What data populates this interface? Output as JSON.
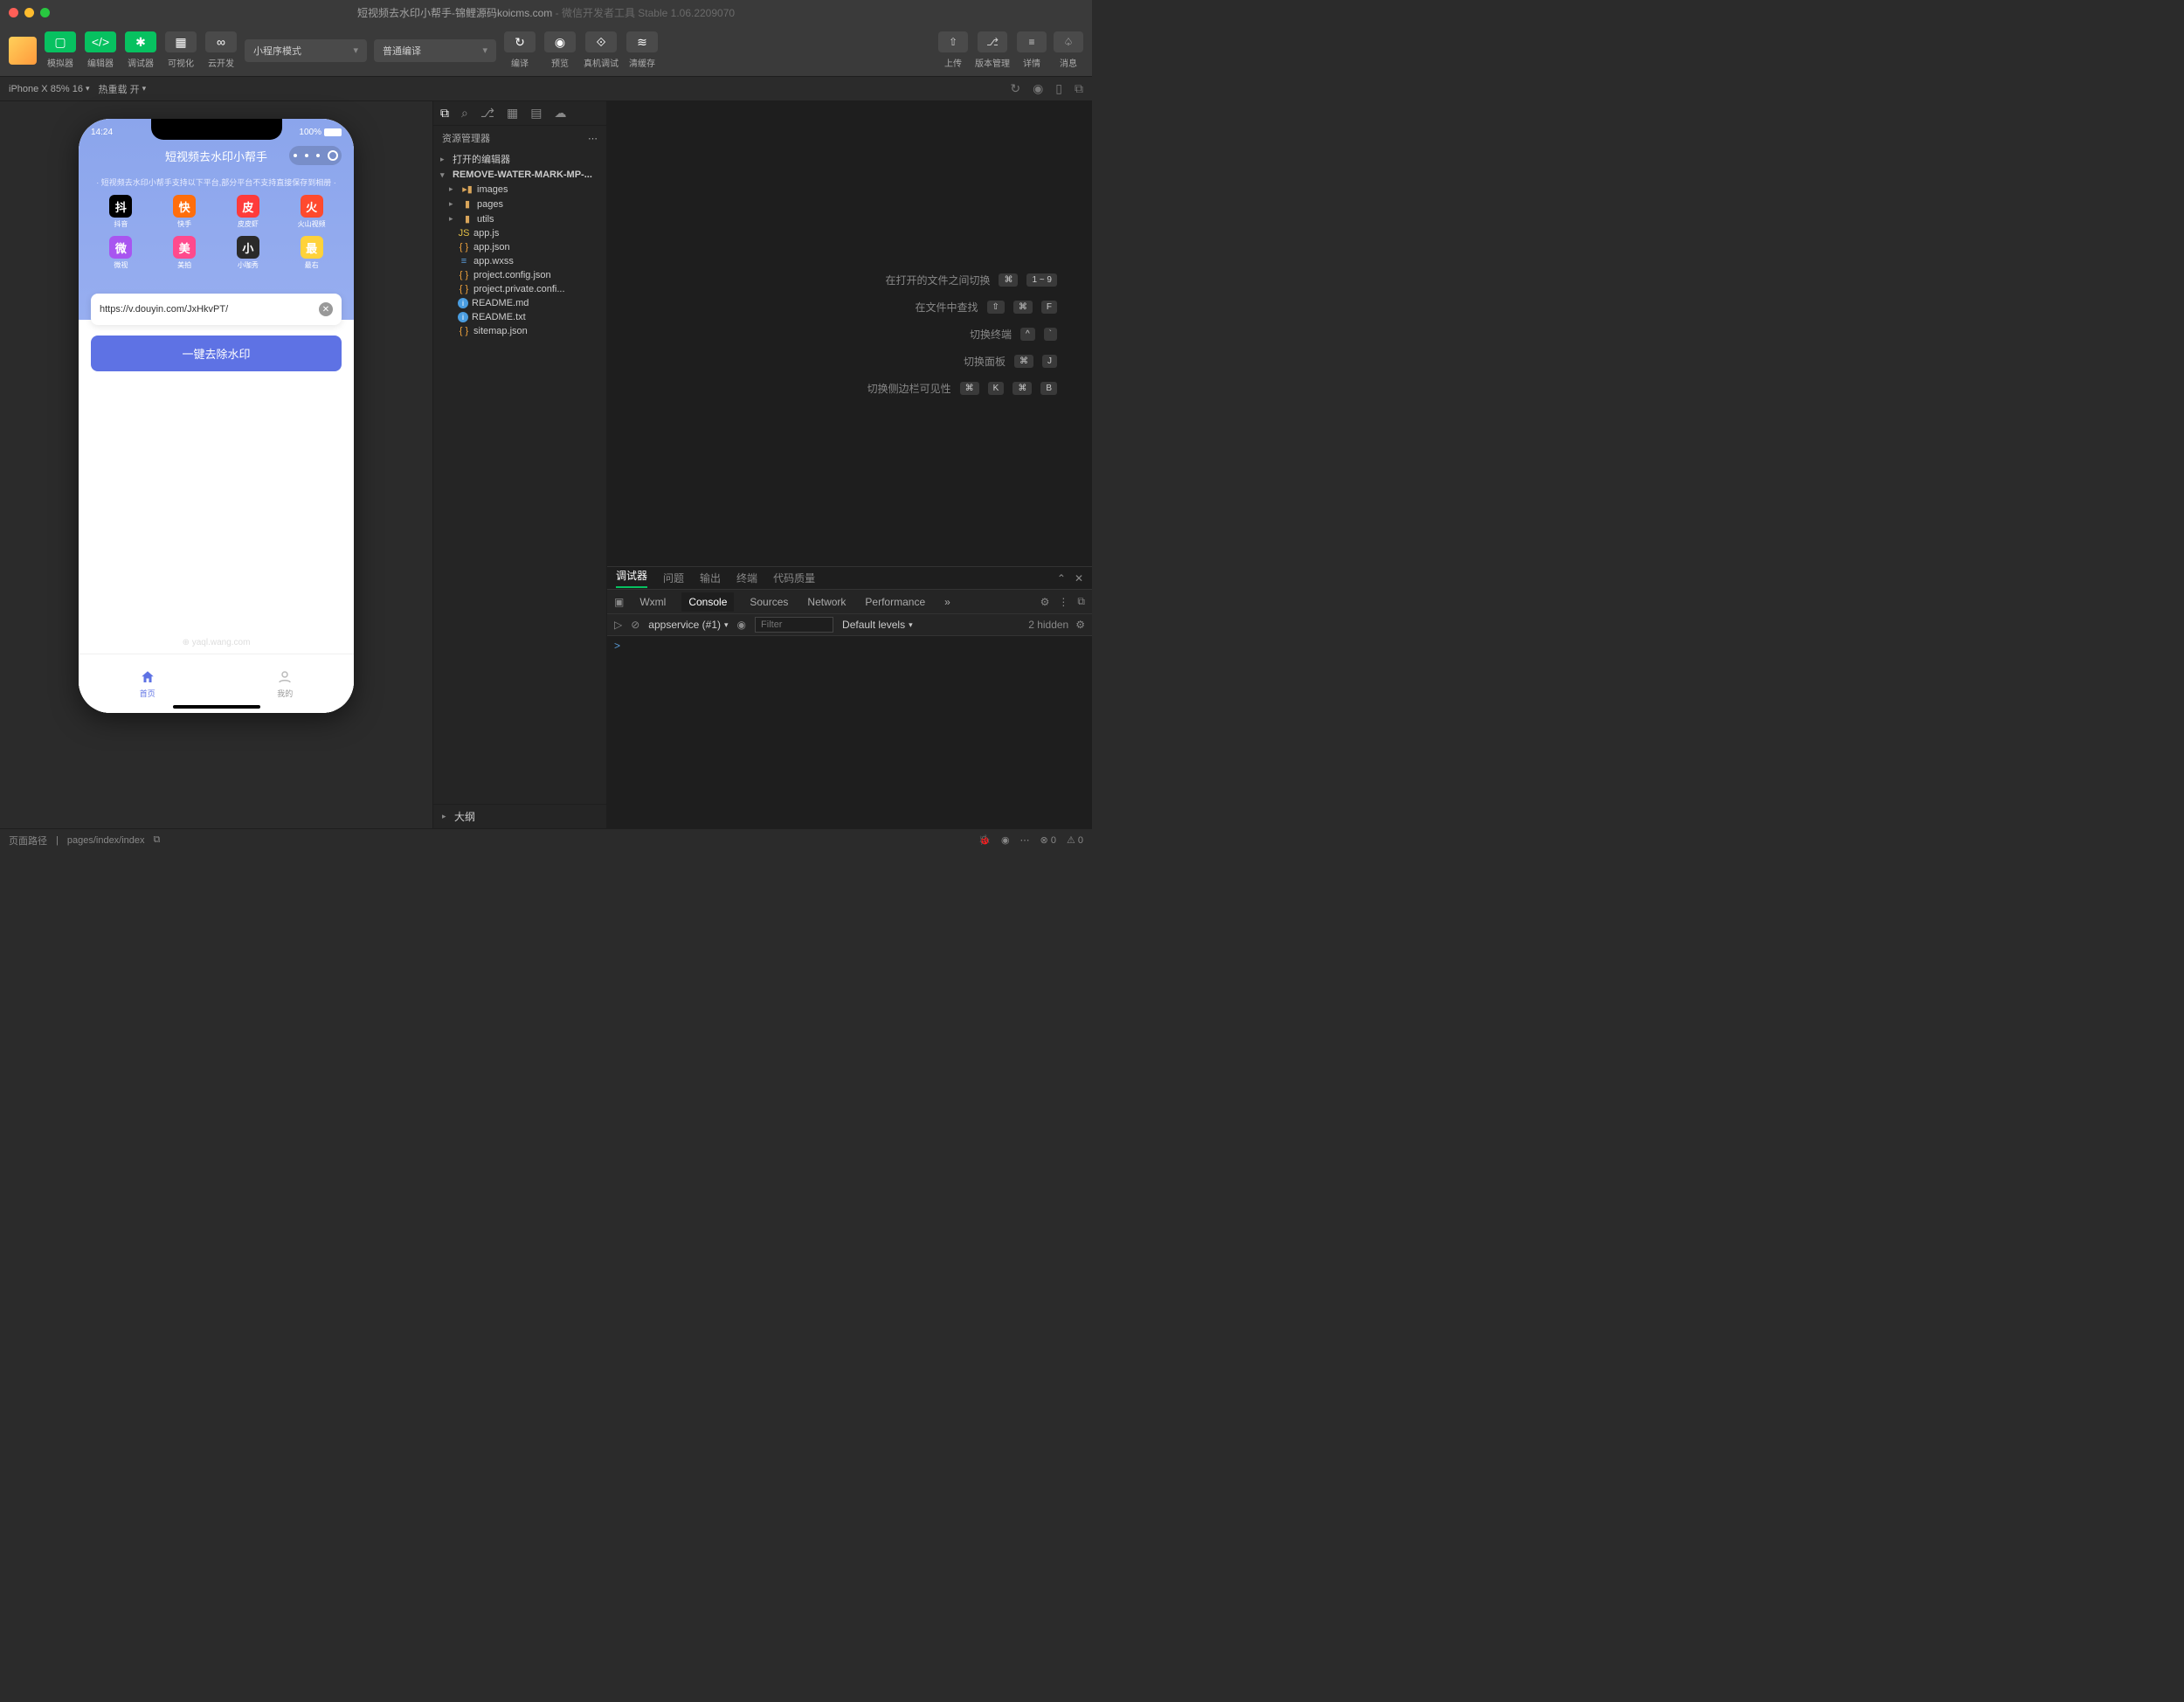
{
  "titlebar": {
    "title": "短视频去水印小帮手-锦鲤源码koicms.com",
    "subtitle": " - 微信开发者工具 Stable 1.06.2209070"
  },
  "toolbar": {
    "simulator": "模拟器",
    "editor": "编辑器",
    "debugger": "调试器",
    "visual": "可视化",
    "cloud": "云开发",
    "mode_select": "小程序模式",
    "compile_select": "普通编译",
    "compile": "编译",
    "preview": "预览",
    "real_debug": "真机调试",
    "clear_cache": "清缓存",
    "upload": "上传",
    "version": "版本管理",
    "details": "详情",
    "messages": "消息"
  },
  "simbar": {
    "device": "iPhone X 85% 16",
    "hot_reload": "热重载 开"
  },
  "explorer": {
    "title": "资源管理器",
    "open_editors": "打开的编辑器",
    "project_name": "REMOVE-WATER-MARK-MP-...",
    "outline": "大纲",
    "folders": {
      "images": "images",
      "pages": "pages",
      "utils": "utils"
    },
    "files": {
      "app_js": "app.js",
      "app_json": "app.json",
      "app_wxss": "app.wxss",
      "project_config": "project.config.json",
      "project_private": "project.private.confi...",
      "readme_md": "README.md",
      "readme_txt": "README.txt",
      "sitemap": "sitemap.json"
    }
  },
  "welcome": {
    "switch_files": "在打开的文件之间切换",
    "switch_files_keys": [
      "⌘",
      "1 ~ 9"
    ],
    "find_in_files": "在文件中查找",
    "find_keys": [
      "⇧",
      "⌘",
      "F"
    ],
    "toggle_terminal": "切换终端",
    "terminal_keys": [
      "^",
      "`"
    ],
    "toggle_panel": "切换面板",
    "panel_keys": [
      "⌘",
      "J"
    ],
    "toggle_sidebar": "切换侧边栏可见性",
    "sidebar_keys": [
      "⌘",
      "K",
      "⌘",
      "B"
    ]
  },
  "devtools": {
    "tabs1": {
      "debugger": "调试器",
      "problems": "问题",
      "output": "输出",
      "terminal": "终端",
      "code_quality": "代码质量"
    },
    "tabs2": {
      "wxml": "Wxml",
      "console": "Console",
      "sources": "Sources",
      "network": "Network",
      "performance": "Performance"
    },
    "context": "appservice (#1)",
    "filter_placeholder": "Filter",
    "levels": "Default levels",
    "hidden": "2 hidden",
    "prompt": ">"
  },
  "phone": {
    "time": "14:24",
    "battery": "100%",
    "title": "短视频去水印小帮手",
    "tip": "· 短视频去水印小帮手支持以下平台,部分平台不支持直接保存到相册 ·",
    "platforms": [
      {
        "name": "抖音",
        "color": "#000"
      },
      {
        "name": "快手",
        "color": "#ff6e0c"
      },
      {
        "name": "皮皮虾",
        "color": "#ff3b3b"
      },
      {
        "name": "火山视频",
        "color": "#ff4a2e"
      },
      {
        "name": "微视",
        "color": "#a855f0"
      },
      {
        "name": "美拍",
        "color": "#ff4a8d"
      },
      {
        "name": "小咖秀",
        "color": "#2a2a2a"
      },
      {
        "name": "最右",
        "color": "#ffd23a"
      }
    ],
    "url_value": "https://v.douyin.com/JxHkvPT/",
    "go_btn": "一键去除水印",
    "watermark_text": "yaql.wang.com",
    "tab_home": "首页",
    "tab_mine": "我的"
  },
  "statusbar": {
    "page_path_label": "页面路径",
    "page_path": "pages/index/index",
    "errors": "0",
    "warnings": "0"
  }
}
